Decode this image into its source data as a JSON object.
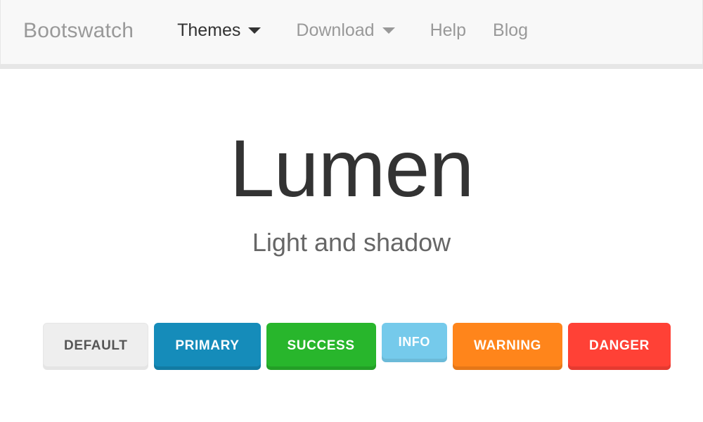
{
  "navbar": {
    "brand": "Bootswatch",
    "items": [
      {
        "label": "Themes",
        "state": "active",
        "caret": true,
        "icon": "chevron-down-icon"
      },
      {
        "label": "Download",
        "state": "muted",
        "caret": true,
        "icon": "chevron-down-icon"
      },
      {
        "label": "Help",
        "state": "muted",
        "caret": false,
        "icon": ""
      },
      {
        "label": "Blog",
        "state": "muted",
        "caret": false,
        "icon": ""
      }
    ],
    "background": "#f8f8f8",
    "border_color": "#e7e7e7",
    "brand_color": "#999999",
    "active_color": "#333333",
    "muted_color": "#999999"
  },
  "hero": {
    "title": "Lumen",
    "subtitle": "Light and shadow",
    "title_color": "#333333",
    "subtitle_color": "#666666"
  },
  "buttons": [
    {
      "label": "Default",
      "variant": "default",
      "bg": "#eeeeee",
      "fg": "#555555"
    },
    {
      "label": "Primary",
      "variant": "primary",
      "bg": "#158cba",
      "fg": "#ffffff"
    },
    {
      "label": "Success",
      "variant": "success",
      "bg": "#28b62c",
      "fg": "#ffffff"
    },
    {
      "label": "Info",
      "variant": "info",
      "bg": "#75caeb",
      "fg": "#ffffff"
    },
    {
      "label": "Warning",
      "variant": "warning",
      "bg": "#ff851b",
      "fg": "#ffffff"
    },
    {
      "label": "Danger",
      "variant": "danger",
      "bg": "#ff4136",
      "fg": "#ffffff"
    }
  ],
  "page": {
    "background": "#ffffff"
  }
}
